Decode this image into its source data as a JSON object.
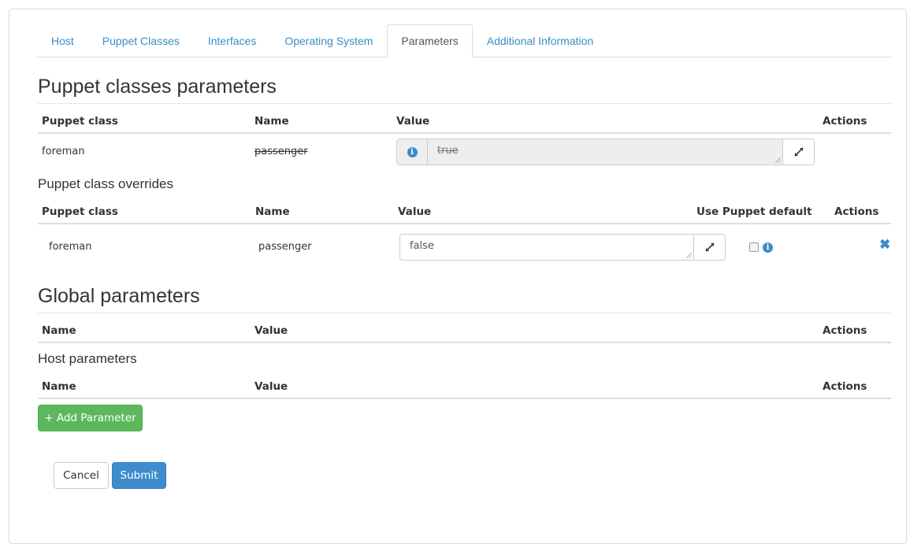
{
  "tabs": [
    {
      "label": "Host",
      "active": false
    },
    {
      "label": "Puppet Classes",
      "active": false
    },
    {
      "label": "Interfaces",
      "active": false
    },
    {
      "label": "Operating System",
      "active": false
    },
    {
      "label": "Parameters",
      "active": true
    },
    {
      "label": "Additional Information",
      "active": false
    }
  ],
  "puppet_classes_parameters": {
    "title": "Puppet classes parameters",
    "headers": {
      "puppet_class": "Puppet class",
      "name": "Name",
      "value": "Value",
      "actions": "Actions"
    },
    "rows": [
      {
        "puppet_class": "foreman",
        "name": "passenger",
        "value": "true",
        "name_struck": true,
        "disabled": true
      }
    ]
  },
  "puppet_class_overrides": {
    "title": "Puppet class overrides",
    "headers": {
      "puppet_class": "Puppet class",
      "name": "Name",
      "value": "Value",
      "use_default": "Use Puppet default",
      "actions": "Actions"
    },
    "rows": [
      {
        "puppet_class": "foreman",
        "name": "passenger",
        "value": "false",
        "use_puppet_default": false
      }
    ]
  },
  "global_parameters": {
    "title": "Global parameters",
    "headers": {
      "name": "Name",
      "value": "Value",
      "actions": "Actions"
    }
  },
  "host_parameters": {
    "title": "Host parameters",
    "headers": {
      "name": "Name",
      "value": "Value",
      "actions": "Actions"
    },
    "add_button": "+ Add Parameter"
  },
  "form_actions": {
    "cancel": "Cancel",
    "submit": "Submit"
  },
  "icons": {
    "info": "info-circle-icon",
    "expand": "expand-arrows-icon",
    "remove": "remove-x-icon"
  },
  "colors": {
    "link": "#3a8cc8",
    "success": "#5cb85c",
    "primary": "#3f8ccc"
  }
}
